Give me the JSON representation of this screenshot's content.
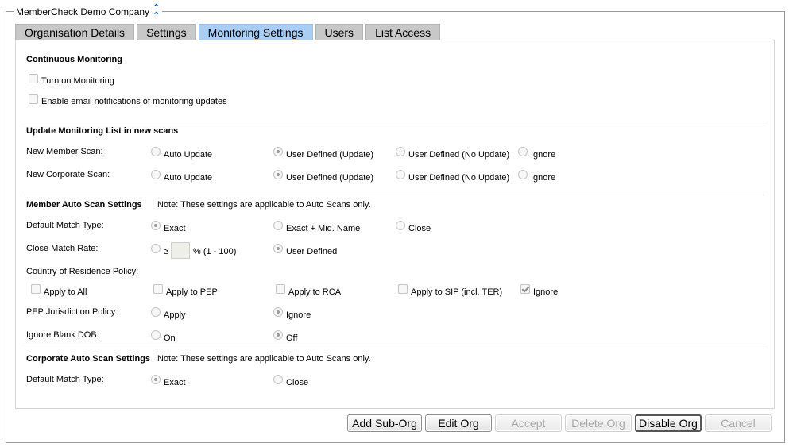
{
  "org_name": "MemberCheck Demo Company",
  "tabs": [
    "Organisation Details",
    "Settings",
    "Monitoring Settings",
    "Users",
    "List Access"
  ],
  "active_tab": "Monitoring Settings",
  "continuous": {
    "title": "Continuous Monitoring",
    "turn_on": {
      "label": "Turn on Monitoring",
      "checked": false
    },
    "email": {
      "label": "Enable email notifications of monitoring updates",
      "checked": false
    }
  },
  "update_list": {
    "title": "Update Monitoring List in new scans",
    "options": [
      "Auto Update",
      "User Defined (Update)",
      "User Defined (No Update)",
      "Ignore"
    ],
    "member_label": "New Member Scan:",
    "member_selected": "User Defined (Update)",
    "corporate_label": "New Corporate Scan:",
    "corporate_selected": "User Defined (Update)"
  },
  "member_auto": {
    "title": "Member Auto Scan Settings",
    "note": "Note: These settings are applicable to Auto Scans only.",
    "match_type_label": "Default Match Type:",
    "match_type_options": [
      "Exact",
      "Exact + Mid. Name",
      "Close"
    ],
    "match_type_selected": "Exact",
    "close_rate_label": "Close Match Rate:",
    "close_rate_symbol": "≥",
    "close_rate_value": "",
    "close_rate_range": "% (1 - 100)",
    "close_rate_user_defined": "User Defined",
    "close_rate_selected": "User Defined",
    "country_label": "Country of Residence Policy:",
    "country_options": [
      {
        "label": "Apply to All",
        "checked": false
      },
      {
        "label": "Apply to PEP",
        "checked": false
      },
      {
        "label": "Apply to RCA",
        "checked": false
      },
      {
        "label": "Apply to SIP (incl. TER)",
        "checked": false
      },
      {
        "label": "Ignore",
        "checked": true
      }
    ],
    "pep_label": "PEP Jurisdiction Policy:",
    "pep_options": [
      "Apply",
      "Ignore"
    ],
    "pep_selected": "Ignore",
    "blank_dob_label": "Ignore Blank DOB:",
    "blank_dob_options": [
      "On",
      "Off"
    ],
    "blank_dob_selected": "Off"
  },
  "corporate_auto": {
    "title": "Corporate Auto Scan Settings",
    "note": "Note: These settings are applicable to Auto Scans only.",
    "match_type_label": "Default Match Type:",
    "match_type_options": [
      "Exact",
      "Close"
    ],
    "match_type_selected": "Exact"
  },
  "buttons": {
    "add_sub_org": {
      "label": "Add Sub-Org",
      "enabled": true
    },
    "edit_org": {
      "label": "Edit Org",
      "enabled": true
    },
    "accept": {
      "label": "Accept",
      "enabled": false
    },
    "delete_org": {
      "label": "Delete Org",
      "enabled": false
    },
    "disable_org": {
      "label": "Disable Org",
      "enabled": true
    },
    "cancel": {
      "label": "Cancel",
      "enabled": false
    }
  },
  "colors": {
    "active_tab": "#a9cdf3",
    "inactive_tab": "#c8c8c8",
    "collapse_icon": "#1a5fb4"
  },
  "icons": {
    "collapse": "chevron-double-up-icon"
  }
}
